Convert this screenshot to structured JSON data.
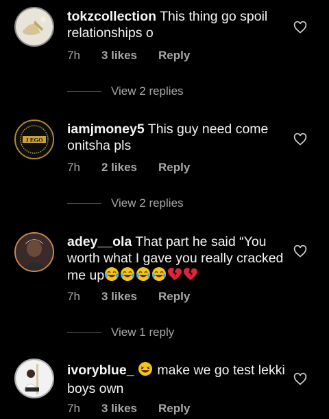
{
  "comments": [
    {
      "username": "tokzcollection",
      "text": " This thing go spoil relationships o",
      "time": "7h",
      "likes": "3 likes",
      "reply": "Reply",
      "view_replies": "View 2 replies",
      "avatar_icon": "shoes-photo-avatar-icon"
    },
    {
      "username": "iamjmoney5",
      "text": " This guy need come onitsha pls",
      "time": "7h",
      "likes": "2 likes",
      "reply": "Reply",
      "view_replies": "View 2 replies",
      "avatar_label": "J EGO",
      "avatar_icon": "jego-logo-avatar-icon"
    },
    {
      "username": "adey__ola",
      "text": " That part he said “You worth what I gave you really cracked me up",
      "emojis": [
        "😂",
        "😂",
        "😂",
        "😂",
        "💔",
        "💔"
      ],
      "time": "7h",
      "likes": "3 likes",
      "reply": "Reply",
      "view_replies": "View 1 reply",
      "avatar_icon": "person-photo-avatar-icon"
    },
    {
      "username": "ivoryblue_",
      "text_prefix_emoji": "😆",
      "text": " make we go test lekki boys own",
      "time": "7h",
      "likes": "3 likes",
      "reply": "Reply",
      "avatar_icon": "person-photo-avatar-icon"
    }
  ],
  "colors": {
    "background": "#000000",
    "text_primary": "#f5f5f5",
    "text_secondary": "#a8a8a8",
    "divider": "#5c5c5c",
    "laugh_emoji": "#f5c518",
    "broken_heart": "#e0243a"
  }
}
